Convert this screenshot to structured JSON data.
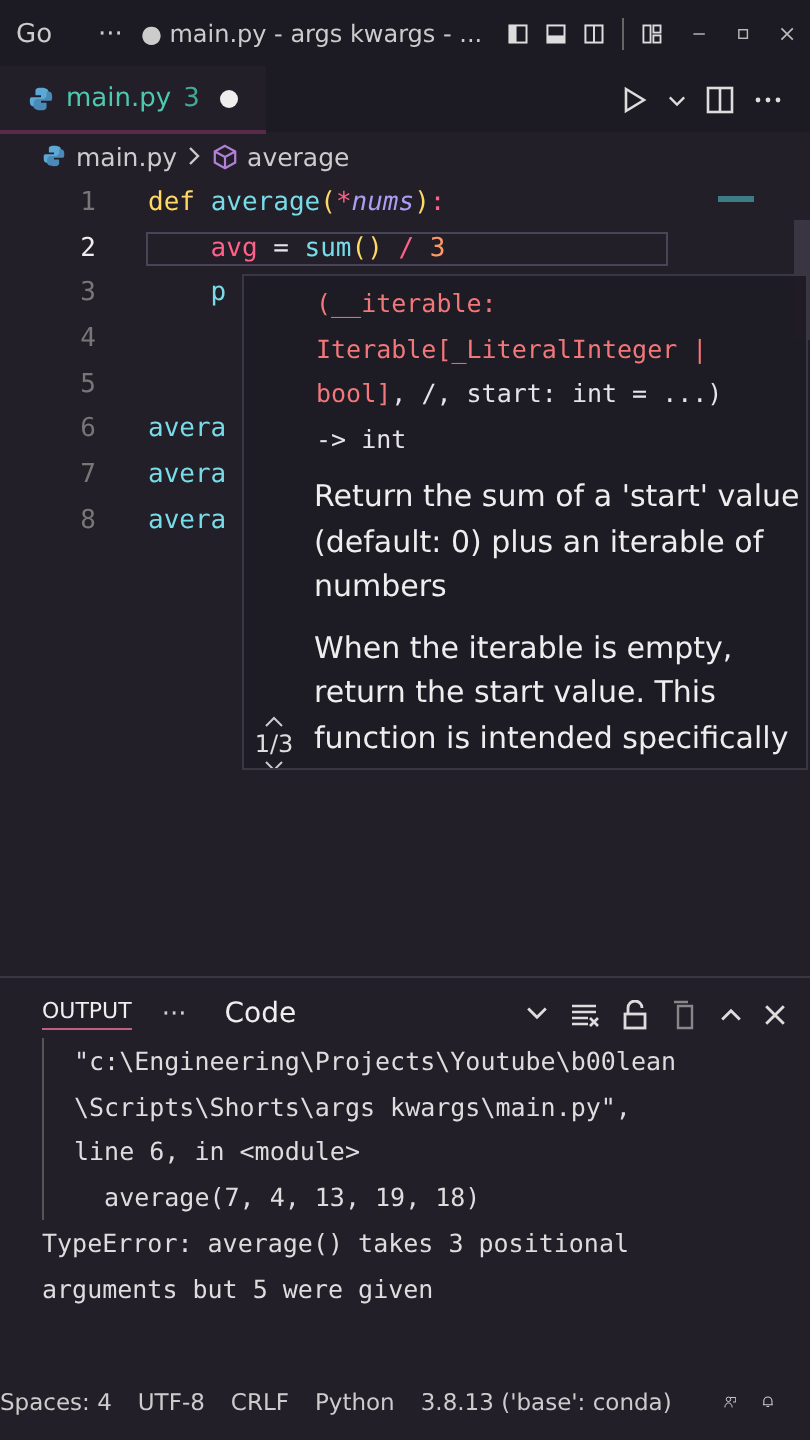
{
  "title_bar": {
    "menu": "Go",
    "more": "···",
    "title": "● main.py - args kwargs - ..."
  },
  "tabs": [
    {
      "label": "main.py",
      "problems": "3",
      "modified": true,
      "selected": true
    }
  ],
  "breadcrumbs": {
    "file": "main.py",
    "symbol": "average"
  },
  "code_lines": [
    {
      "number": "1",
      "current": false,
      "indented": false,
      "tokens": [
        {
          "kind": "keyword",
          "text": "def "
        },
        {
          "kind": "function",
          "text": "average"
        },
        {
          "kind": "paren",
          "text": "("
        },
        {
          "kind": "operator",
          "text": "*"
        },
        {
          "kind": "param",
          "text": "nums"
        },
        {
          "kind": "paren",
          "text": ")"
        },
        {
          "kind": "operator",
          "text": ":"
        }
      ]
    },
    {
      "number": "2",
      "current": true,
      "indented": true,
      "tokens": [
        {
          "kind": "variable",
          "text": "avg"
        },
        {
          "kind": "plain",
          "text": " = "
        },
        {
          "kind": "function",
          "text": "sum"
        },
        {
          "kind": "paren",
          "text": "()"
        },
        {
          "kind": "operator",
          "text": " / "
        },
        {
          "kind": "number",
          "text": "3"
        }
      ]
    },
    {
      "number": "3",
      "current": false,
      "indented": true,
      "tokens": [
        {
          "kind": "function",
          "text": "p"
        }
      ]
    },
    {
      "number": "4",
      "current": false
    },
    {
      "number": "5",
      "current": false
    },
    {
      "number": "6",
      "current": false,
      "indented": false,
      "tokens": [
        {
          "kind": "function",
          "text": "avera"
        }
      ]
    },
    {
      "number": "7",
      "current": false,
      "indented": false,
      "tokens": [
        {
          "kind": "function",
          "text": "avera"
        }
      ]
    },
    {
      "number": "8",
      "current": false,
      "indented": false,
      "tokens": [
        {
          "kind": "function",
          "text": "avera"
        }
      ]
    }
  ],
  "hover": {
    "signature": [
      [
        {
          "kind": "param",
          "text": "(__iterable:"
        }
      ],
      [
        {
          "kind": "param",
          "text": "Iterable[_LiteralInteger |"
        }
      ],
      [
        {
          "kind": "param",
          "text": "bool]"
        },
        {
          "kind": "plain",
          "text": ", /, start: int = ...)"
        }
      ],
      [
        {
          "kind": "plain",
          "text": "-> int"
        }
      ]
    ],
    "paragraphs": [
      "Return the sum of a 'start' value (default: 0) plus an iterable of numbers",
      "When the iterable is empty, return the start value. This function is intended specifically"
    ],
    "counter": "1/3"
  },
  "panel": {
    "tab": "OUTPUT",
    "more": "···",
    "channel": "Code",
    "lines": [
      {
        "indent": true,
        "text": "\"c:\\Engineering\\Projects\\Youtube\\b00lean"
      },
      {
        "indent": true,
        "text": "\\Scripts\\Shorts\\args kwargs\\main.py\","
      },
      {
        "indent": true,
        "text": "line 6, in <module>"
      },
      {
        "indent": true,
        "text": "  average(7, 4, 13, 19, 18)"
      },
      {
        "indent": false,
        "text": "TypeError: average() takes 3 positional"
      },
      {
        "indent": false,
        "text": "arguments but 5 were given"
      }
    ]
  },
  "status_bar": [
    "Spaces: 4",
    "UTF-8",
    "CRLF",
    "Python",
    "3.8.13 ('base': conda)"
  ]
}
